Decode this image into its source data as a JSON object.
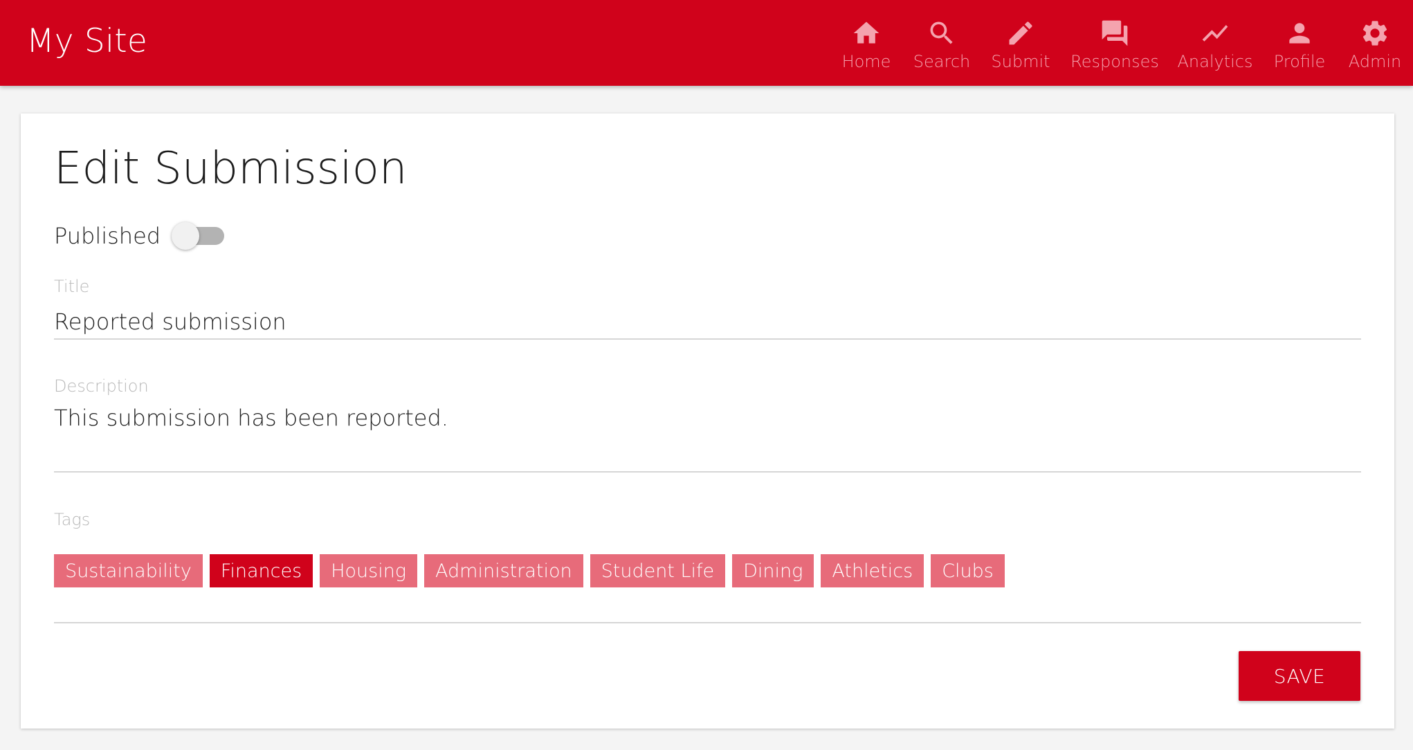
{
  "app": {
    "site_title": "My Site"
  },
  "nav": {
    "items": [
      {
        "label": "Home",
        "icon": "home-icon"
      },
      {
        "label": "Search",
        "icon": "search-icon"
      },
      {
        "label": "Submit",
        "icon": "pencil-icon"
      },
      {
        "label": "Responses",
        "icon": "chat-bubbles-icon"
      },
      {
        "label": "Analytics",
        "icon": "trending-line-icon"
      },
      {
        "label": "Profile",
        "icon": "person-icon"
      },
      {
        "label": "Admin",
        "icon": "gear-icon"
      }
    ]
  },
  "form": {
    "heading": "Edit Submission",
    "published": {
      "label": "Published",
      "checked": false
    },
    "title": {
      "label": "Title",
      "value": "Reported submission"
    },
    "description": {
      "label": "Description",
      "value": "This submission has been reported."
    },
    "tags": {
      "label": "Tags",
      "items": [
        {
          "label": "Sustainability",
          "selected": false
        },
        {
          "label": "Finances",
          "selected": true
        },
        {
          "label": "Housing",
          "selected": false
        },
        {
          "label": "Administration",
          "selected": false
        },
        {
          "label": "Student Life",
          "selected": false
        },
        {
          "label": "Dining",
          "selected": false
        },
        {
          "label": "Athletics",
          "selected": false
        },
        {
          "label": "Clubs",
          "selected": false
        }
      ]
    },
    "save_label": "SAVE"
  },
  "colors": {
    "brand": "#d0021b",
    "tag_unselected": "#e76b7a",
    "nav_text": "#f4a3ae"
  }
}
